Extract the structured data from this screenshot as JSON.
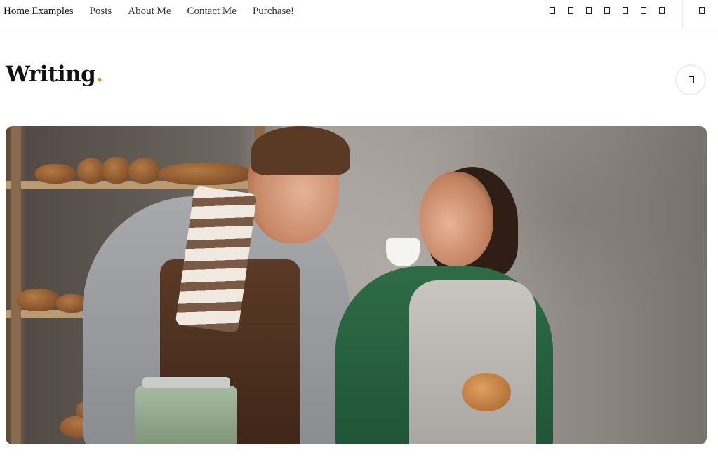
{
  "nav": {
    "items": [
      {
        "label": "Home Examples",
        "active": true
      },
      {
        "label": "Posts",
        "active": false
      },
      {
        "label": "About Me",
        "active": false
      },
      {
        "label": "Contact Me",
        "active": false
      },
      {
        "label": "Purchase!",
        "active": false
      }
    ]
  },
  "social_icons": [
    "social-icon-1",
    "social-icon-2",
    "social-icon-3",
    "social-icon-4",
    "social-icon-5",
    "social-icon-6",
    "social-icon-7"
  ],
  "header_search_icon": "search-icon",
  "site": {
    "logo_text": "Writing",
    "logo_dot": ".",
    "accent_color": "#f28c1b"
  },
  "menu_button_icon": "menu-icon",
  "hero": {
    "alt": "Bearded man in apron grinding coffee while smiling woman in green sweater sips from a white cup in a bakery"
  }
}
